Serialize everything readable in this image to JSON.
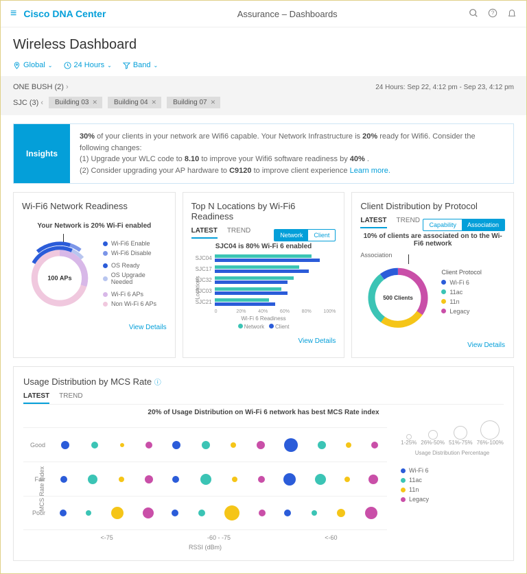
{
  "header": {
    "brand": "Cisco DNA Center",
    "title": "Assurance – Dashboards",
    "page_title": "Wireless Dashboard"
  },
  "filters": {
    "location": "Global",
    "time": "24 Hours",
    "band": "Band"
  },
  "breadcrumb": {
    "site1": "ONE BUSH (2)",
    "site2": "SJC (3)",
    "chips": [
      "Building 03",
      "Building 04",
      "Building 07"
    ],
    "time_range": "24 Hours: Sep 22, 4:12 pm - Sep 23, 4:12 pm"
  },
  "insights": {
    "label": "Insights",
    "line1a": "30%",
    "line1b": " of your clients in your network are Wifi6 capable. Your Network Infrastructure is ",
    "line1c": "20%",
    "line1d": " ready for Wifi6. Consider the following changes:",
    "line2a": "(1) Upgrade your WLC code to ",
    "line2b": "8.10",
    "line2c": " to improve your Wifi6 software readiness by ",
    "line2d": "40%",
    "line2e": " .",
    "line3a": "(2) Consider upgrading your AP hardware to ",
    "line3b": "C9120",
    "line3c": " to improve client experience ",
    "learn_more": "Learn more."
  },
  "card1": {
    "title": "Wi-Fi6 Network Readiness",
    "subtitle": "Your Network is 20% Wi-Fi enabled",
    "center": "100 APs",
    "legend": [
      "Wi-Fi6 Enable",
      "Wi-Fi6 Disable",
      "OS Ready",
      "OS Upgrade Needed",
      "Wi-Fi 6 APs",
      "Non Wi-Fi 6 APs"
    ],
    "view": "View Details"
  },
  "card2": {
    "title": "Top N Locations by Wi-Fi6 Readiness",
    "tab_latest": "LATEST",
    "tab_trend": "TREND",
    "pill_network": "Network",
    "pill_client": "Client",
    "subtitle": "SJC04 is 80% Wi-Fi 6 enabled",
    "legend_net": "Network",
    "legend_client": "Client",
    "ylabel": "Locations",
    "xlabel": "Wi-Fi 6 Readiness",
    "view": "View Details"
  },
  "card3": {
    "title": "Client Distribution by Protocol",
    "tab_latest": "LATEST",
    "tab_trend": "TREND",
    "pill_cap": "Capability",
    "pill_assoc": "Association",
    "subtitle": "10% of clients are associated on to the Wi-Fi6 network",
    "assoc_label": "Association",
    "center": "500 Clients",
    "legend_title": "Client Protocol",
    "legend": [
      "Wi-Fi 6",
      "11ac",
      "11n",
      "Legacy"
    ],
    "view": "View Details"
  },
  "card4": {
    "title": "Usage Distribution by MCS Rate",
    "tab_latest": "LATEST",
    "tab_trend": "TREND",
    "subtitle": "20% of Usage Distribution on Wi-Fi 6 network has best MCS Rate index",
    "ylabels": [
      "Good",
      "Fair",
      "Poor"
    ],
    "xlabels": [
      "<-75",
      "-60 - -75",
      "<-60"
    ],
    "xtitle": "RSSI (dBm)",
    "ytitle": "MCS Rate Index",
    "size_labels": [
      "1-25%",
      "26%-50%",
      "51%-75%",
      "76%-100%"
    ],
    "size_caption": "Usage Distribution Percentage",
    "legend": [
      "Wi-Fi 6",
      "11ac",
      "11n",
      "Legacy"
    ]
  },
  "colors": {
    "wifi6": "#2b5cd9",
    "ac11": "#3bc4b5",
    "n11": "#f5c518",
    "legacy": "#c94fa8",
    "enable": "#2b5cd9",
    "disable": "#7b95e8",
    "osready": "#2b5cd9",
    "osupgrade": "#b8c5ef",
    "wifi6ap": "#d8b8e8",
    "nonwifi6": "#f0c8de"
  },
  "chart_data": [
    {
      "type": "pie",
      "title": "Wi-Fi6 Network Readiness",
      "center_label": "100 APs",
      "rings": [
        {
          "name": "outer",
          "series": [
            {
              "name": "Wi-Fi6 Enable",
              "value": 20
            },
            {
              "name": "Wi-Fi6 Disable",
              "value": 10
            }
          ]
        },
        {
          "name": "middle",
          "series": [
            {
              "name": "OS Ready",
              "value": 25
            },
            {
              "name": "OS Upgrade Needed",
              "value": 15
            }
          ]
        },
        {
          "name": "inner",
          "series": [
            {
              "name": "Wi-Fi 6 APs",
              "value": 30
            },
            {
              "name": "Non Wi-Fi 6 APs",
              "value": 70
            }
          ]
        }
      ]
    },
    {
      "type": "bar",
      "title": "Top N Locations by Wi-Fi6 Readiness",
      "orientation": "horizontal",
      "categories": [
        "SJC04",
        "SJC17",
        "SJC32",
        "SJC03",
        "SJC21"
      ],
      "series": [
        {
          "name": "Network",
          "values": [
            80,
            70,
            65,
            55,
            45
          ]
        },
        {
          "name": "Client",
          "values": [
            87,
            78,
            60,
            60,
            50
          ]
        }
      ],
      "xlabel": "Wi-Fi 6 Readiness",
      "ylabel": "Locations",
      "xticks": [
        0,
        20,
        40,
        60,
        80,
        100
      ],
      "xlim": [
        0,
        100
      ]
    },
    {
      "type": "pie",
      "title": "Client Distribution by Protocol",
      "center_label": "500 Clients",
      "series": [
        {
          "name": "Wi-Fi 6",
          "value": 10
        },
        {
          "name": "11ac",
          "value": 30
        },
        {
          "name": "11n",
          "value": 25
        },
        {
          "name": "Legacy",
          "value": 35
        }
      ]
    },
    {
      "type": "scatter",
      "title": "Usage Distribution by MCS Rate",
      "x_categories": [
        "<-75",
        "-60 - -75",
        "<-60"
      ],
      "y_categories": [
        "Good",
        "Fair",
        "Poor"
      ],
      "series": [
        "Wi-Fi 6",
        "11ac",
        "11n",
        "Legacy"
      ],
      "size_encoding": "Usage Distribution Percentage",
      "size_buckets": [
        "1-25%",
        "26%-50%",
        "51%-75%",
        "76%-100%"
      ],
      "points": [
        {
          "y": "Good",
          "x": "<-75",
          "sizes": [
            12,
            10,
            6,
            10
          ]
        },
        {
          "y": "Good",
          "x": "-60 - -75",
          "sizes": [
            12,
            12,
            8,
            12
          ]
        },
        {
          "y": "Good",
          "x": "<-60",
          "sizes": [
            20,
            12,
            8,
            10
          ]
        },
        {
          "y": "Fair",
          "x": "<-75",
          "sizes": [
            10,
            14,
            8,
            12
          ]
        },
        {
          "y": "Fair",
          "x": "-60 - -75",
          "sizes": [
            10,
            16,
            8,
            10
          ]
        },
        {
          "y": "Fair",
          "x": "<-60",
          "sizes": [
            18,
            16,
            8,
            14
          ]
        },
        {
          "y": "Poor",
          "x": "<-75",
          "sizes": [
            10,
            8,
            18,
            16
          ]
        },
        {
          "y": "Poor",
          "x": "-60 - -75",
          "sizes": [
            10,
            10,
            22,
            10
          ]
        },
        {
          "y": "Poor",
          "x": "<-60",
          "sizes": [
            10,
            8,
            12,
            18
          ]
        }
      ]
    }
  ]
}
